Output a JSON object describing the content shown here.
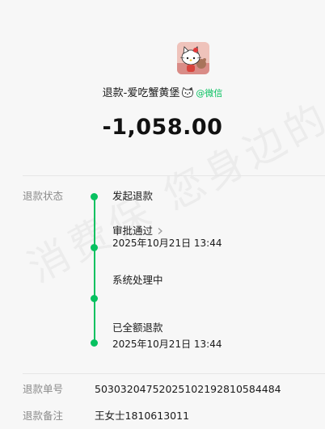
{
  "header": {
    "merchant_name": "退款-爱吃蟹黄堡",
    "via": "@微信",
    "amount": "-1,058.00"
  },
  "status": {
    "label": "退款状态",
    "steps": [
      {
        "title": "发起退款",
        "time": ""
      },
      {
        "title": "审批通过",
        "time": "2025年10月21日 13:44"
      },
      {
        "title": "系统处理中",
        "time": ""
      },
      {
        "title": "已全额退款",
        "time": "2025年10月21日 13:44"
      }
    ]
  },
  "details": {
    "refund_no_label": "退款单号",
    "refund_no": "50303204752025102192810584484",
    "remark_label": "退款备注",
    "remark": "王女士1810613011"
  },
  "watermark": "消费保 您身边的",
  "colors": {
    "accent": "#07c160",
    "background": "#f7f7f7",
    "muted_text": "#8a8a8a"
  },
  "icons": {
    "avatar": "hello-kitty-avatar",
    "merchant_emoji": "kitty-face-icon",
    "approval_chevron": "chevron-right-icon"
  }
}
